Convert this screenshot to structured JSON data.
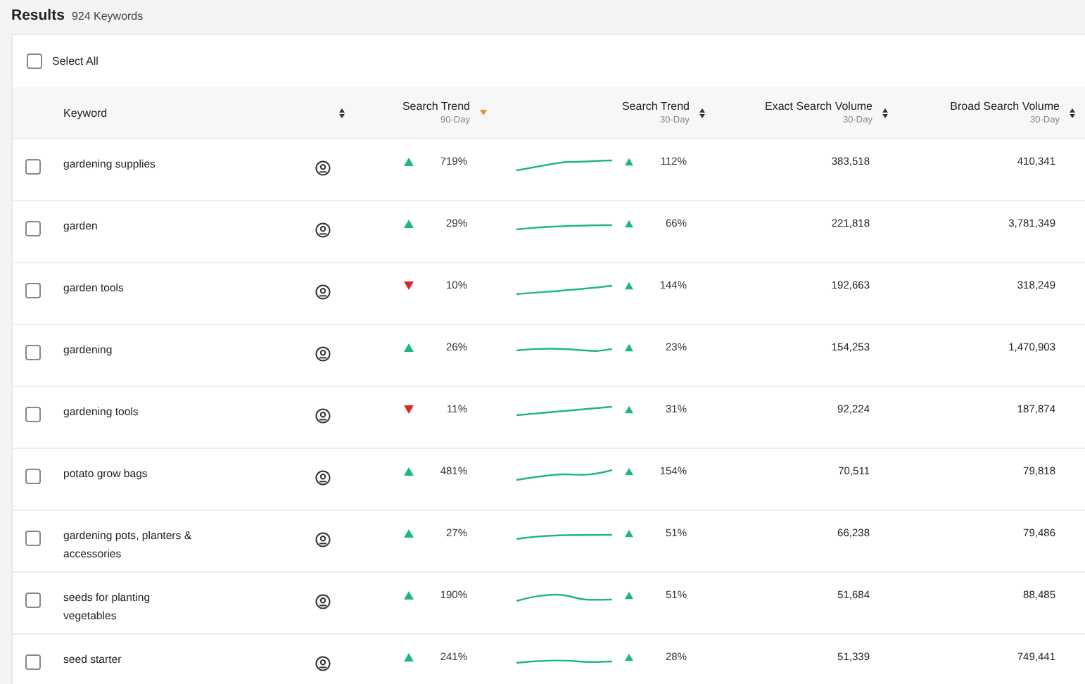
{
  "header": {
    "title": "Results",
    "count": "924 Keywords"
  },
  "select_all": {
    "label": "Select All",
    "checked": false
  },
  "columns": [
    {
      "label": "Keyword",
      "sorted": false
    },
    {
      "label": "Search Trend",
      "sub": "90-Day",
      "sorted": true
    },
    {
      "label": "Search Trend",
      "sub": "30-Day",
      "sorted": false
    },
    {
      "label": "Exact Search Volume",
      "sub": "30-Day",
      "sorted": false
    },
    {
      "label": "Broad Search Volume",
      "sub": "30-Day",
      "sorted": false
    }
  ],
  "rows": [
    {
      "keyword": "gardening supplies",
      "checked": false,
      "trend90": {
        "up": true,
        "value": "719%"
      },
      "trend30": {
        "up": true,
        "value": "112%"
      },
      "exact": "383,518",
      "broad": "410,341"
    },
    {
      "keyword": "garden",
      "checked": false,
      "trend90": {
        "up": true,
        "value": "29%"
      },
      "trend30": {
        "up": true,
        "value": "66%"
      },
      "exact": "221,818",
      "broad": "3,781,349"
    },
    {
      "keyword": "garden tools",
      "checked": false,
      "trend90": {
        "up": false,
        "value": "10%"
      },
      "trend30": {
        "up": true,
        "value": "144%"
      },
      "exact": "192,663",
      "broad": "318,249"
    },
    {
      "keyword": "gardening",
      "checked": false,
      "trend90": {
        "up": true,
        "value": "26%"
      },
      "trend30": {
        "up": true,
        "value": "23%"
      },
      "exact": "154,253",
      "broad": "1,470,903"
    },
    {
      "keyword": "gardening tools",
      "checked": false,
      "trend90": {
        "up": false,
        "value": "11%"
      },
      "trend30": {
        "up": true,
        "value": "31%"
      },
      "exact": "92,224",
      "broad": "187,874"
    },
    {
      "keyword": "potato grow bags",
      "checked": false,
      "trend90": {
        "up": true,
        "value": "481%"
      },
      "trend30": {
        "up": true,
        "value": "154%"
      },
      "exact": "70,511",
      "broad": "79,818"
    },
    {
      "keyword": "gardening pots, planters & accessories",
      "checked": false,
      "trend90": {
        "up": true,
        "value": "27%"
      },
      "trend30": {
        "up": true,
        "value": "51%"
      },
      "exact": "66,238",
      "broad": "79,486"
    },
    {
      "keyword": "seeds for planting vegetables",
      "checked": false,
      "trend90": {
        "up": true,
        "value": "190%"
      },
      "trend30": {
        "up": true,
        "value": "51%"
      },
      "exact": "51,684",
      "broad": "88,485"
    },
    {
      "keyword": "seed starter",
      "checked": false,
      "trend90": {
        "up": true,
        "value": "241%"
      },
      "trend30": {
        "up": true,
        "value": "28%"
      },
      "exact": "51,339",
      "broad": "749,441"
    }
  ]
}
